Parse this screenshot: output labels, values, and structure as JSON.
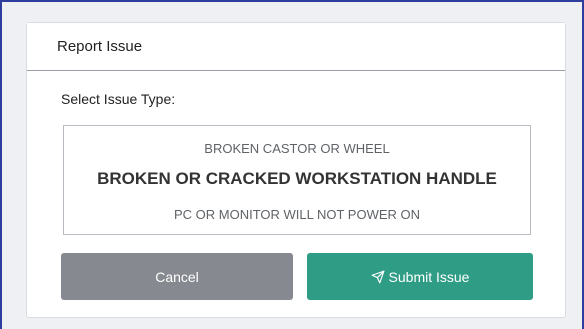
{
  "dialog": {
    "title": "Report Issue",
    "prompt": "Select Issue Type:"
  },
  "picker": {
    "options": [
      "BROKEN CASTOR OR WHEEL",
      "BROKEN OR CRACKED WORKSTATION HANDLE",
      "PC OR MONITOR WILL NOT POWER ON"
    ],
    "selected": "BROKEN OR CRACKED WORKSTATION HANDLE"
  },
  "buttons": {
    "cancel_label": "Cancel",
    "submit_label": "Submit Issue",
    "submit_icon": "send-icon"
  },
  "colors": {
    "cancel": "#86898f",
    "submit": "#2f9d86",
    "frame_accent": "#2f3e9e"
  }
}
